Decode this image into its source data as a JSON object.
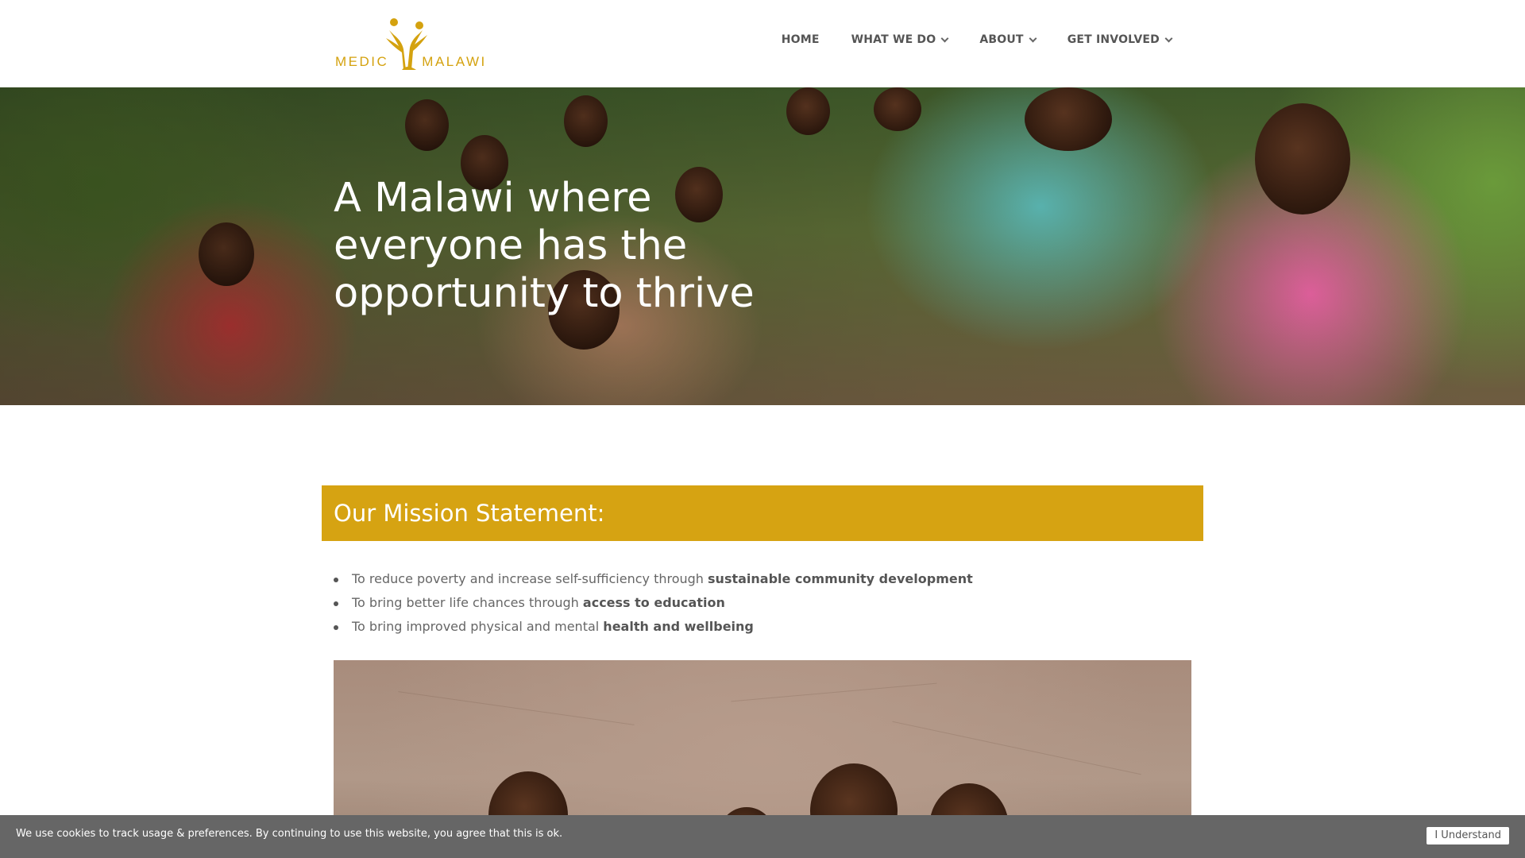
{
  "logo": {
    "text_left": "MEDIC",
    "text_right": "MALAWI",
    "brand_color": "#d4a20f"
  },
  "nav": {
    "items": [
      {
        "label": "HOME",
        "has_dropdown": false
      },
      {
        "label": "WHAT WE DO",
        "has_dropdown": true
      },
      {
        "label": "ABOUT",
        "has_dropdown": true
      },
      {
        "label": "GET INVOLVED",
        "has_dropdown": true
      }
    ]
  },
  "hero": {
    "title": "A Malawi where everyone has the opportunity to thrive"
  },
  "mission": {
    "title": "Our Mission Statement:",
    "bar_color": "#d6a312",
    "items": [
      {
        "text": "To reduce poverty and increase self-sufficiency through ",
        "bold": "sustainable community development"
      },
      {
        "text": "To bring better life chances through ",
        "bold": "access to education"
      },
      {
        "text": "To bring improved physical and mental ",
        "bold": "health and wellbeing"
      }
    ]
  },
  "cookie": {
    "message": "We use cookies to track usage & preferences. By continuing to use this website, you agree that this is ok.",
    "button": "I Understand"
  }
}
